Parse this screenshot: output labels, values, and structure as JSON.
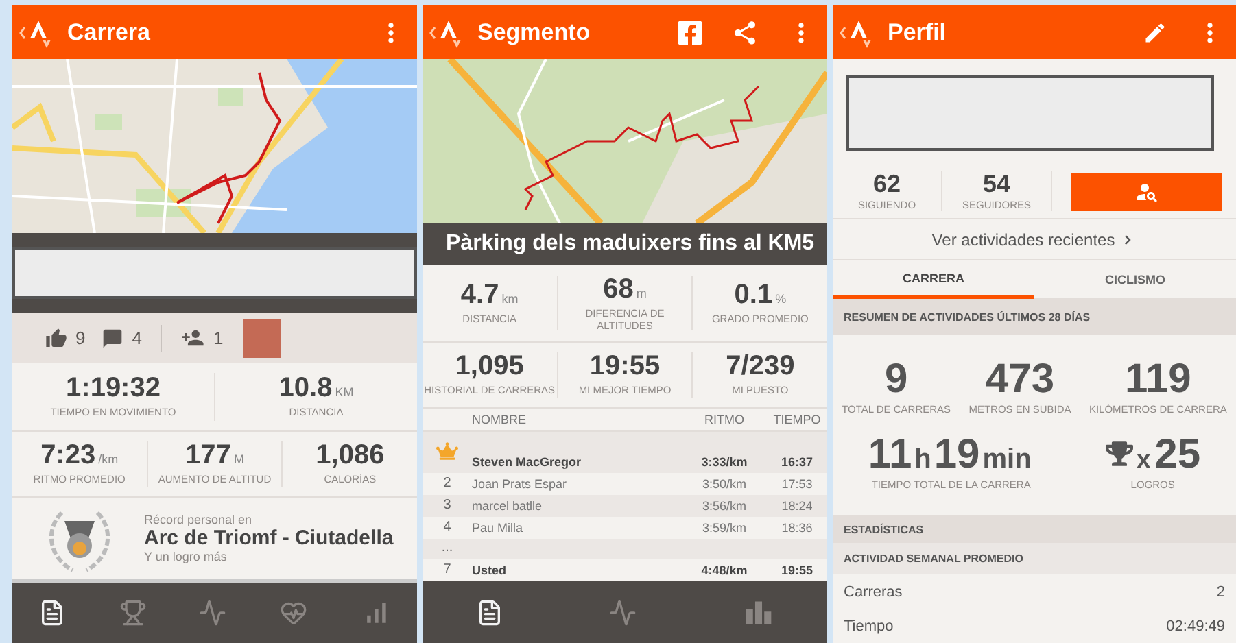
{
  "activity": {
    "title": "Carrera",
    "social": {
      "likes": "9",
      "comments": "4",
      "followers": "1"
    },
    "stat_rows": [
      [
        {
          "value": "1:19:32",
          "label": "TIEMPO EN MOVIMIENTO"
        },
        {
          "value": "10.8",
          "unit": "KM",
          "label": "DISTANCIA"
        }
      ],
      [
        {
          "value": "7:23",
          "unit": "/km",
          "label": "RITMO PROMEDIO"
        },
        {
          "value": "177",
          "unit": "M",
          "label": "AUMENTO DE ALTITUD"
        },
        {
          "value": "1,086",
          "label": "CALORÍAS"
        }
      ]
    ],
    "record": {
      "caption": "Récord personal en",
      "name": "Arc de Triomf - Ciutadella",
      "note": "Y un logro más"
    },
    "nav": [
      {
        "kind": "document",
        "selected": true
      },
      {
        "kind": "trophy",
        "selected": false
      },
      {
        "kind": "activity",
        "selected": false
      },
      {
        "kind": "heart",
        "selected": false
      },
      {
        "kind": "chart",
        "selected": false
      }
    ]
  },
  "segment": {
    "title": "Segmento",
    "name": "Pàrking dels maduixers fins al KM5",
    "stat_rows": [
      [
        {
          "value": "4.7",
          "unit": "km",
          "label": "DISTANCIA"
        },
        {
          "value": "68",
          "unit": "m",
          "label": "DIFERENCIA DE ALTITUDES"
        },
        {
          "value": "0.1",
          "unit": "%",
          "label": "GRADO PROMEDIO"
        }
      ],
      [
        {
          "value": "1,095",
          "label": "HISTORIAL DE CARRERAS"
        },
        {
          "value": "19:55",
          "label": "MI MEJOR TIEMPO"
        },
        {
          "value": "7/239",
          "label": "MI PUESTO"
        }
      ]
    ],
    "table": {
      "columns": [
        "NOMBRE",
        "RITMO",
        "TIEMPO"
      ],
      "rows": [
        {
          "kind": "crown",
          "rank": "",
          "name": "Steven MacGregor",
          "pace": "3:33/km",
          "time": "16:37",
          "highlighted": true
        },
        {
          "kind": "rank",
          "rank": "2",
          "name": "Joan Prats Espar",
          "pace": "3:50/km",
          "time": "17:53",
          "highlighted": false
        },
        {
          "kind": "rank",
          "rank": "3",
          "name": "marcel batlle",
          "pace": "3:56/km",
          "time": "18:24",
          "highlighted": false
        },
        {
          "kind": "rank",
          "rank": "4",
          "name": "Pau Milla",
          "pace": "3:59/km",
          "time": "18:36",
          "highlighted": false
        },
        {
          "kind": "gap",
          "rank": "..."
        },
        {
          "kind": "rank",
          "rank": "7",
          "name": "Usted",
          "pace": "4:48/km",
          "time": "19:55",
          "highlighted": true
        }
      ]
    },
    "nav": [
      {
        "kind": "document",
        "selected": true
      },
      {
        "kind": "activity",
        "selected": false
      },
      {
        "kind": "podium",
        "selected": false
      }
    ]
  },
  "profile": {
    "title": "Perfil",
    "counts": [
      {
        "value": "62",
        "label": "SIGUIENDO"
      },
      {
        "value": "54",
        "label": "SEGUIDORES"
      }
    ],
    "link": "Ver actividades recientes",
    "tabs": [
      {
        "label": "CARRERA",
        "selected": true
      },
      {
        "label": "CICLISMO",
        "selected": false
      }
    ],
    "summary_header": "RESUMEN DE ACTIVIDADES ÚLTIMOS 28 DÍAS",
    "summary": [
      {
        "value": "9",
        "label": "TOTAL DE CARRERAS"
      },
      {
        "value": "473",
        "label": "METROS EN SUBIDA"
      },
      {
        "value": "119",
        "label": "KILÓMETROS DE CARRERA"
      }
    ],
    "total_time": {
      "parts": [
        {
          "kind": "number",
          "text": "11"
        },
        {
          "kind": "unit",
          "text": "h"
        },
        {
          "kind": "number",
          "text": "19"
        },
        {
          "kind": "unit",
          "text": "min"
        }
      ],
      "label": "TIEMPO TOTAL DE LA CARRERA"
    },
    "achievements": {
      "prefix": "x",
      "value": "25",
      "label": "LOGROS"
    },
    "stats_header": "ESTADÍSTICAS",
    "weekly_header": "ACTIVIDAD SEMANAL PROMEDIO",
    "weekly": [
      {
        "label": "Carreras",
        "value": "2"
      },
      {
        "label": "Tiempo",
        "value": "02:49:49"
      }
    ]
  }
}
